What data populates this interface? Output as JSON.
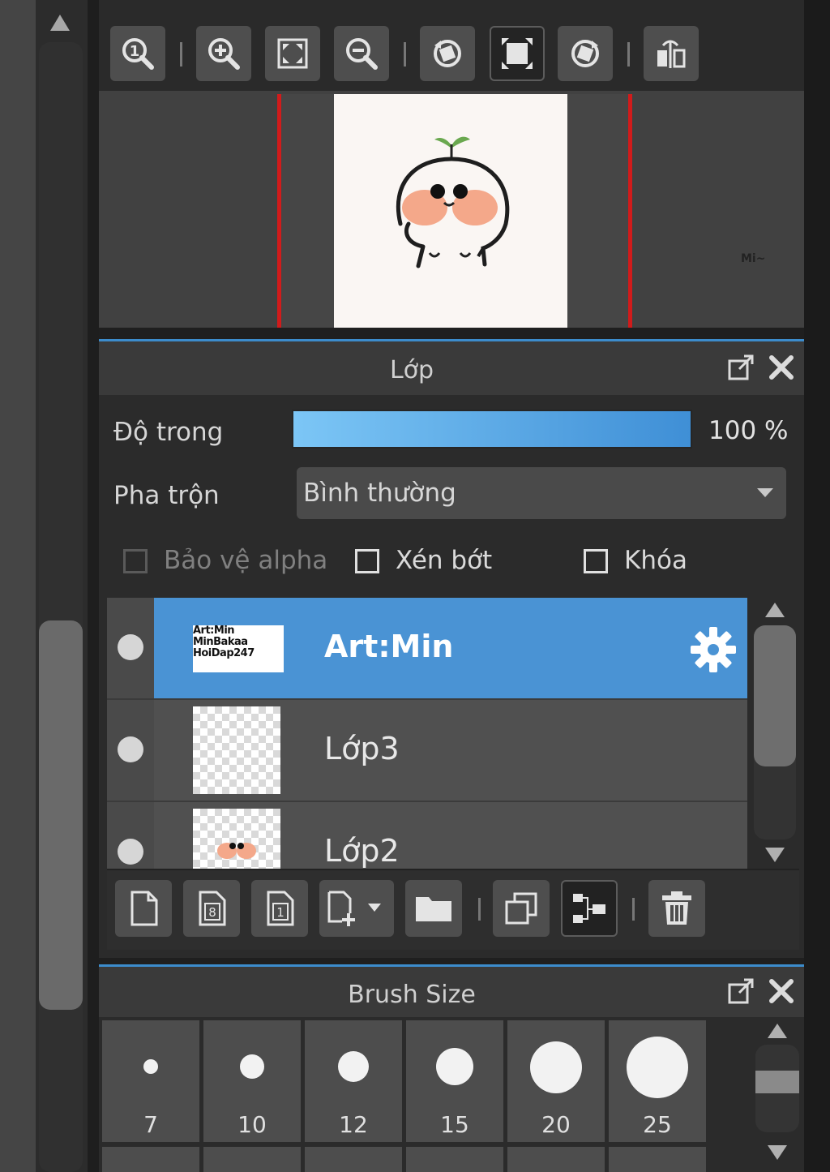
{
  "navigator": {
    "toolbar": [
      {
        "name": "zoom-actual-icon"
      },
      {
        "name": "zoom-in-icon"
      },
      {
        "name": "fit-screen-icon"
      },
      {
        "name": "zoom-out-icon"
      },
      {
        "name": "rotate-left-icon"
      },
      {
        "name": "reset-rotation-icon"
      },
      {
        "name": "rotate-right-icon"
      },
      {
        "name": "flip-horizontal-icon"
      }
    ],
    "preview_signature": "Mi~"
  },
  "layer_panel": {
    "title": "Lớp",
    "opacity_label": "Độ trong",
    "opacity_value": "100 %",
    "opacity_fraction": 1.0,
    "blend_label": "Pha trộn",
    "blend_value": "Bình thường",
    "protect_alpha_label": "Bảo vệ alpha",
    "clipping_label": "Xén bớt",
    "lock_label": "Khóa",
    "layers": [
      {
        "name": "Art:Min",
        "thumb_text": "Art:Min MinBakaa HoiDap247",
        "selected": true
      },
      {
        "name": "Lớp3",
        "selected": false
      },
      {
        "name": "Lớp2",
        "selected": false
      }
    ],
    "toolbar_icons": [
      "new-layer-icon",
      "new-8bit-layer-icon",
      "new-1bit-layer-icon",
      "add-layer-menu-icon",
      "new-folder-icon",
      "duplicate-layer-icon",
      "merge-down-icon",
      "delete-layer-icon"
    ]
  },
  "brush_panel": {
    "title": "Brush Size",
    "sizes": [
      "7",
      "10",
      "12",
      "15",
      "20",
      "25"
    ]
  },
  "colors": {
    "accent": "#4a93d4",
    "selection_border": "#d11b1b",
    "panel_dark": "#2b2b2b"
  }
}
